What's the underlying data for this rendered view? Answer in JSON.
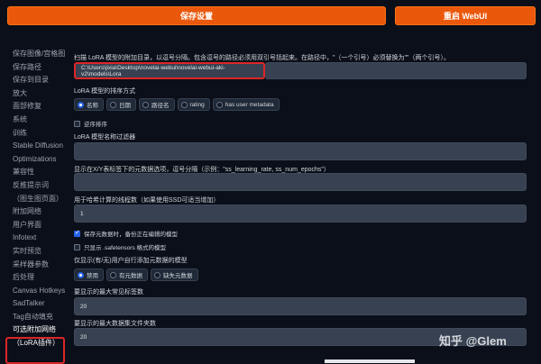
{
  "topbar": {
    "save_label": "保存设置",
    "restart_label": "重启 WebUI"
  },
  "sidebar": {
    "items": [
      {
        "label": "保存图像/宫格图"
      },
      {
        "label": "保存路径"
      },
      {
        "label": "保存到目录"
      },
      {
        "label": "放大"
      },
      {
        "label": "面部修复"
      },
      {
        "label": "系统"
      },
      {
        "label": "训练"
      },
      {
        "label": "Stable Diffusion"
      },
      {
        "label": "Optimizations"
      },
      {
        "label": "兼容性"
      },
      {
        "label": "反推提示词"
      },
      {
        "label": "（图生图页面）"
      },
      {
        "label": "附加网络"
      },
      {
        "label": "用户界面"
      },
      {
        "label": "Infotext"
      },
      {
        "label": "实时预览"
      },
      {
        "label": "采样器参数"
      },
      {
        "label": "后处理"
      },
      {
        "label": "Canvas Hotkeys"
      },
      {
        "label": "SadTalker"
      },
      {
        "label": "Tag自动填充"
      },
      {
        "label": "可选附加网络"
      },
      {
        "label": "（LoRA插件）"
      }
    ]
  },
  "main": {
    "scan_dir_label": "扫描 LoRA 模型的附加目录，以逗号分隔。包含逗号的路径必须用双引号括起来。在路径中，\"（一个引号）必须替换为\"\"（两个引号）。",
    "scan_dir_value": "C:\\Users\\jixia\\Desktop\\novelai-webui\\novelai-webui-aki-v2\\models\\Lora",
    "sort_label": "LoRA 模型的排序方式",
    "sort_options": [
      "名称",
      "日期",
      "路径名",
      "rating",
      "has user metadata"
    ],
    "reverse_label": "逆序排序",
    "filter_label": "LoRA 模型名称过滤器",
    "filter_value": "",
    "xy_label": "显示在X/Y表标签下的元数据选项，逗号分隔（示例：\"ss_learning_rate, ss_num_epochs\"）",
    "xy_value": "",
    "threads_label": "用于哈希计算的线程数（如果使用SSD可适当增加）",
    "threads_value": "1",
    "backup_label": "保存元数据时，备份正在编辑的模型",
    "safetensors_label": "只显示 .safetensors 格式的模型",
    "metadata_filter_label": "仅显示(有/无)用户自行添加元数据的模型",
    "metadata_options": [
      "禁用",
      "有元数据",
      "缺失元数据"
    ],
    "max_tags_label": "要显示的最大常见标签数",
    "max_tags_value": "20",
    "max_dataset_label": "要显示的最大数据集文件夹数",
    "max_dataset_value": "20"
  },
  "watermark": "知乎 @Glem",
  "colors": {
    "accent": "#ea580c",
    "background": "#0b0f19",
    "panel": "#374151",
    "highlight": "#dc2626",
    "selected": "#2563eb"
  }
}
